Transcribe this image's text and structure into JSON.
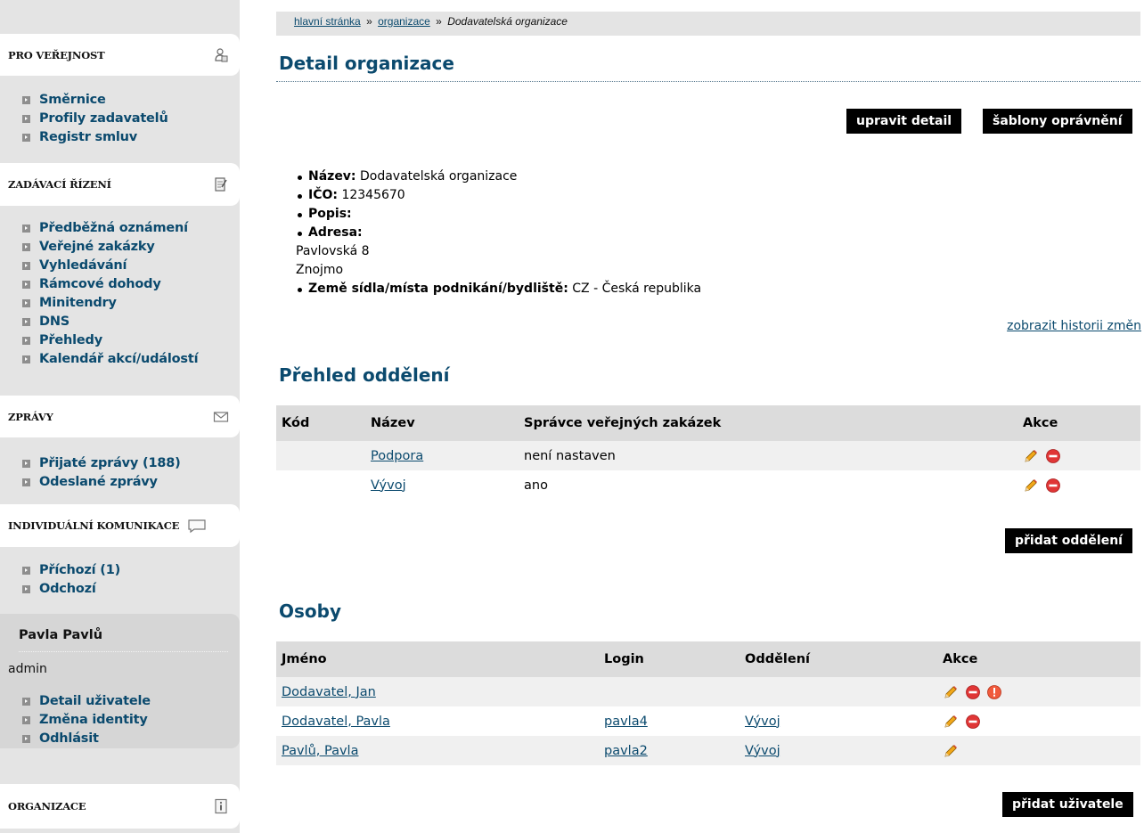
{
  "sidebar": {
    "public": {
      "title": "PRO VEŘEJNOST",
      "items": [
        "Směrnice",
        "Profily zadavatelů",
        "Registr smluv"
      ]
    },
    "procurement": {
      "title": "ZADÁVACÍ ŘÍZENÍ",
      "items": [
        "Předběžná oznámení",
        "Veřejné zakázky",
        "Vyhledávání",
        "Rámcové dohody",
        "Minitendry",
        "DNS",
        "Přehledy",
        "Kalendář akcí/událostí"
      ]
    },
    "messages": {
      "title": "ZPRÁVY",
      "items": [
        "Přijaté zprávy (188)",
        "Odeslané zprávy"
      ]
    },
    "communication": {
      "title": "INDIVIDUÁLNÍ KOMUNIKACE",
      "items": [
        "Příchozí (1)",
        "Odchozí"
      ]
    },
    "user": {
      "name": "Pavla Pavlů",
      "role": "admin",
      "items": [
        "Detail uživatele",
        "Změna identity",
        "Odhlásit"
      ]
    },
    "organization": {
      "title": "ORGANIZACE"
    }
  },
  "breadcrumb": {
    "home": "hlavní stránka",
    "sep": "»",
    "organizations": "organizace",
    "current": "Dodavatelská organizace"
  },
  "page": {
    "title": "Detail organizace",
    "edit_button": "upravit detail",
    "permissions_button": "šablony oprávnění",
    "history_link": "zobrazit historii změn"
  },
  "details": {
    "name_label": "Název:",
    "name_value": "Dodavatelská organizace",
    "ico_label": "IČO:",
    "ico_value": "12345670",
    "desc_label": "Popis:",
    "address_label": "Adresa:",
    "address_line1": "Pavlovská 8",
    "address_line2": "Znojmo",
    "country_label": "Země sídla/místa podnikání/bydliště:",
    "country_value": "CZ - Česká republika"
  },
  "departments": {
    "title": "Přehled oddělení",
    "headers": {
      "code": "Kód",
      "name": "Název",
      "manager": "Správce veřejných zakázek",
      "actions": "Akce"
    },
    "rows": [
      {
        "code": "",
        "name": "Podpora",
        "manager": "není nastaven"
      },
      {
        "code": "",
        "name": "Vývoj",
        "manager": "ano"
      }
    ],
    "add_button": "přidat oddělení"
  },
  "persons": {
    "title": "Osoby",
    "headers": {
      "name": "Jméno",
      "login": "Login",
      "department": "Oddělení",
      "actions": "Akce"
    },
    "rows": [
      {
        "name": "Dodavatel, Jan",
        "login": "",
        "department": ""
      },
      {
        "name": "Dodavatel, Pavla",
        "login": "pavla4",
        "department": "Vývoj"
      },
      {
        "name": "Pavlů, Pavla",
        "login": "pavla2",
        "department": "Vývoj"
      }
    ],
    "add_button": "přidat uživatele"
  }
}
